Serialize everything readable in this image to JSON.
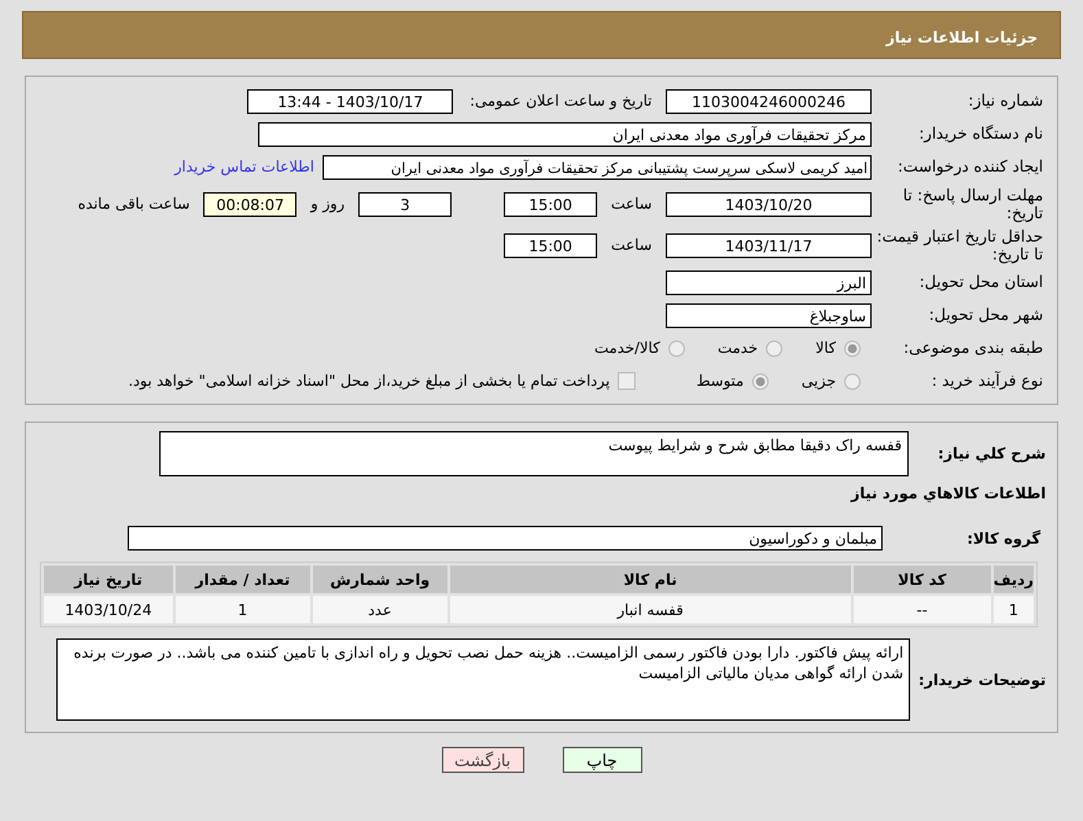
{
  "header": {
    "title": "جزئیات اطلاعات نیاز"
  },
  "details": {
    "need_number": {
      "label": "شماره نیاز:",
      "value": "1103004246000246"
    },
    "announce": {
      "label": "تاریخ و ساعت اعلان عمومی:",
      "value": "1403/10/17 - 13:44"
    },
    "buyer": {
      "label": "نام دستگاه خریدار:",
      "value": "مرکز تحقیقات فرآوری مواد معدنی ایران"
    },
    "creator": {
      "label": "ایجاد کننده درخواست:",
      "value": "امید کریمی لاسکی سرپرست پشتیبانی مرکز تحقیقات فرآوری مواد معدنی ایران",
      "link": "اطلاعات تماس خریدار"
    },
    "deadline": {
      "label": "مهلت ارسال پاسخ: تا تاریخ:",
      "date": "1403/10/20",
      "time_label": "ساعت",
      "time": "15:00",
      "days": "3",
      "days_label": "روز و",
      "remaining": "00:08:07",
      "remaining_label": "ساعت باقی مانده"
    },
    "validity": {
      "label": "حداقل تاریخ اعتبار قیمت: تا تاریخ:",
      "date": "1403/11/17",
      "time_label": "ساعت",
      "time": "15:00"
    },
    "province": {
      "label": "استان محل تحویل:",
      "value": "البرز"
    },
    "city": {
      "label": "شهر محل تحویل:",
      "value": "ساوجبلاغ"
    },
    "category": {
      "label": "طبقه بندی موضوعی:",
      "options": [
        {
          "label": "کالا",
          "selected": true
        },
        {
          "label": "خدمت",
          "selected": false
        },
        {
          "label": "کالا/خدمت",
          "selected": false
        }
      ]
    },
    "process": {
      "label": "نوع فرآیند خرید :",
      "options": [
        {
          "label": "جزیی",
          "selected": false
        },
        {
          "label": "متوسط",
          "selected": true
        }
      ],
      "treasury": {
        "checked": false,
        "text": "پرداخت تمام یا بخشی از مبلغ خرید،از محل \"اسناد خزانه اسلامی\" خواهد بود."
      }
    }
  },
  "goods": {
    "description": {
      "label": "شرح کلي نياز:",
      "value": "قفسه راک دقیقا مطابق شرح و شرایط پیوست"
    },
    "heading": "اطلاعات کالاهاي مورد نياز",
    "group": {
      "label": "گروه کالا:",
      "value": "مبلمان و دکوراسیون"
    },
    "table": {
      "columns": [
        "ردیف",
        "کد کالا",
        "نام کالا",
        "واحد شمارش",
        "تعداد / مقدار",
        "تاریخ نیاز"
      ],
      "rows": [
        [
          "1",
          "--",
          "قفسه انبار",
          "عدد",
          "1",
          "1403/10/24"
        ]
      ]
    },
    "notes": {
      "label": "توضیحات خریدار:",
      "value": "ارائه پیش فاکتور. دارا بودن فاکتور رسمی الزامیست.. هزینه حمل نصب تحویل و راه اندازی با تامین کننده می باشد.. در صورت برنده شدن ارائه گواهی مدیان مالیاتی الزامیست"
    }
  },
  "buttons": [
    {
      "label": "چاپ",
      "kind": "print"
    },
    {
      "label": "بازگشت",
      "kind": "back"
    }
  ]
}
